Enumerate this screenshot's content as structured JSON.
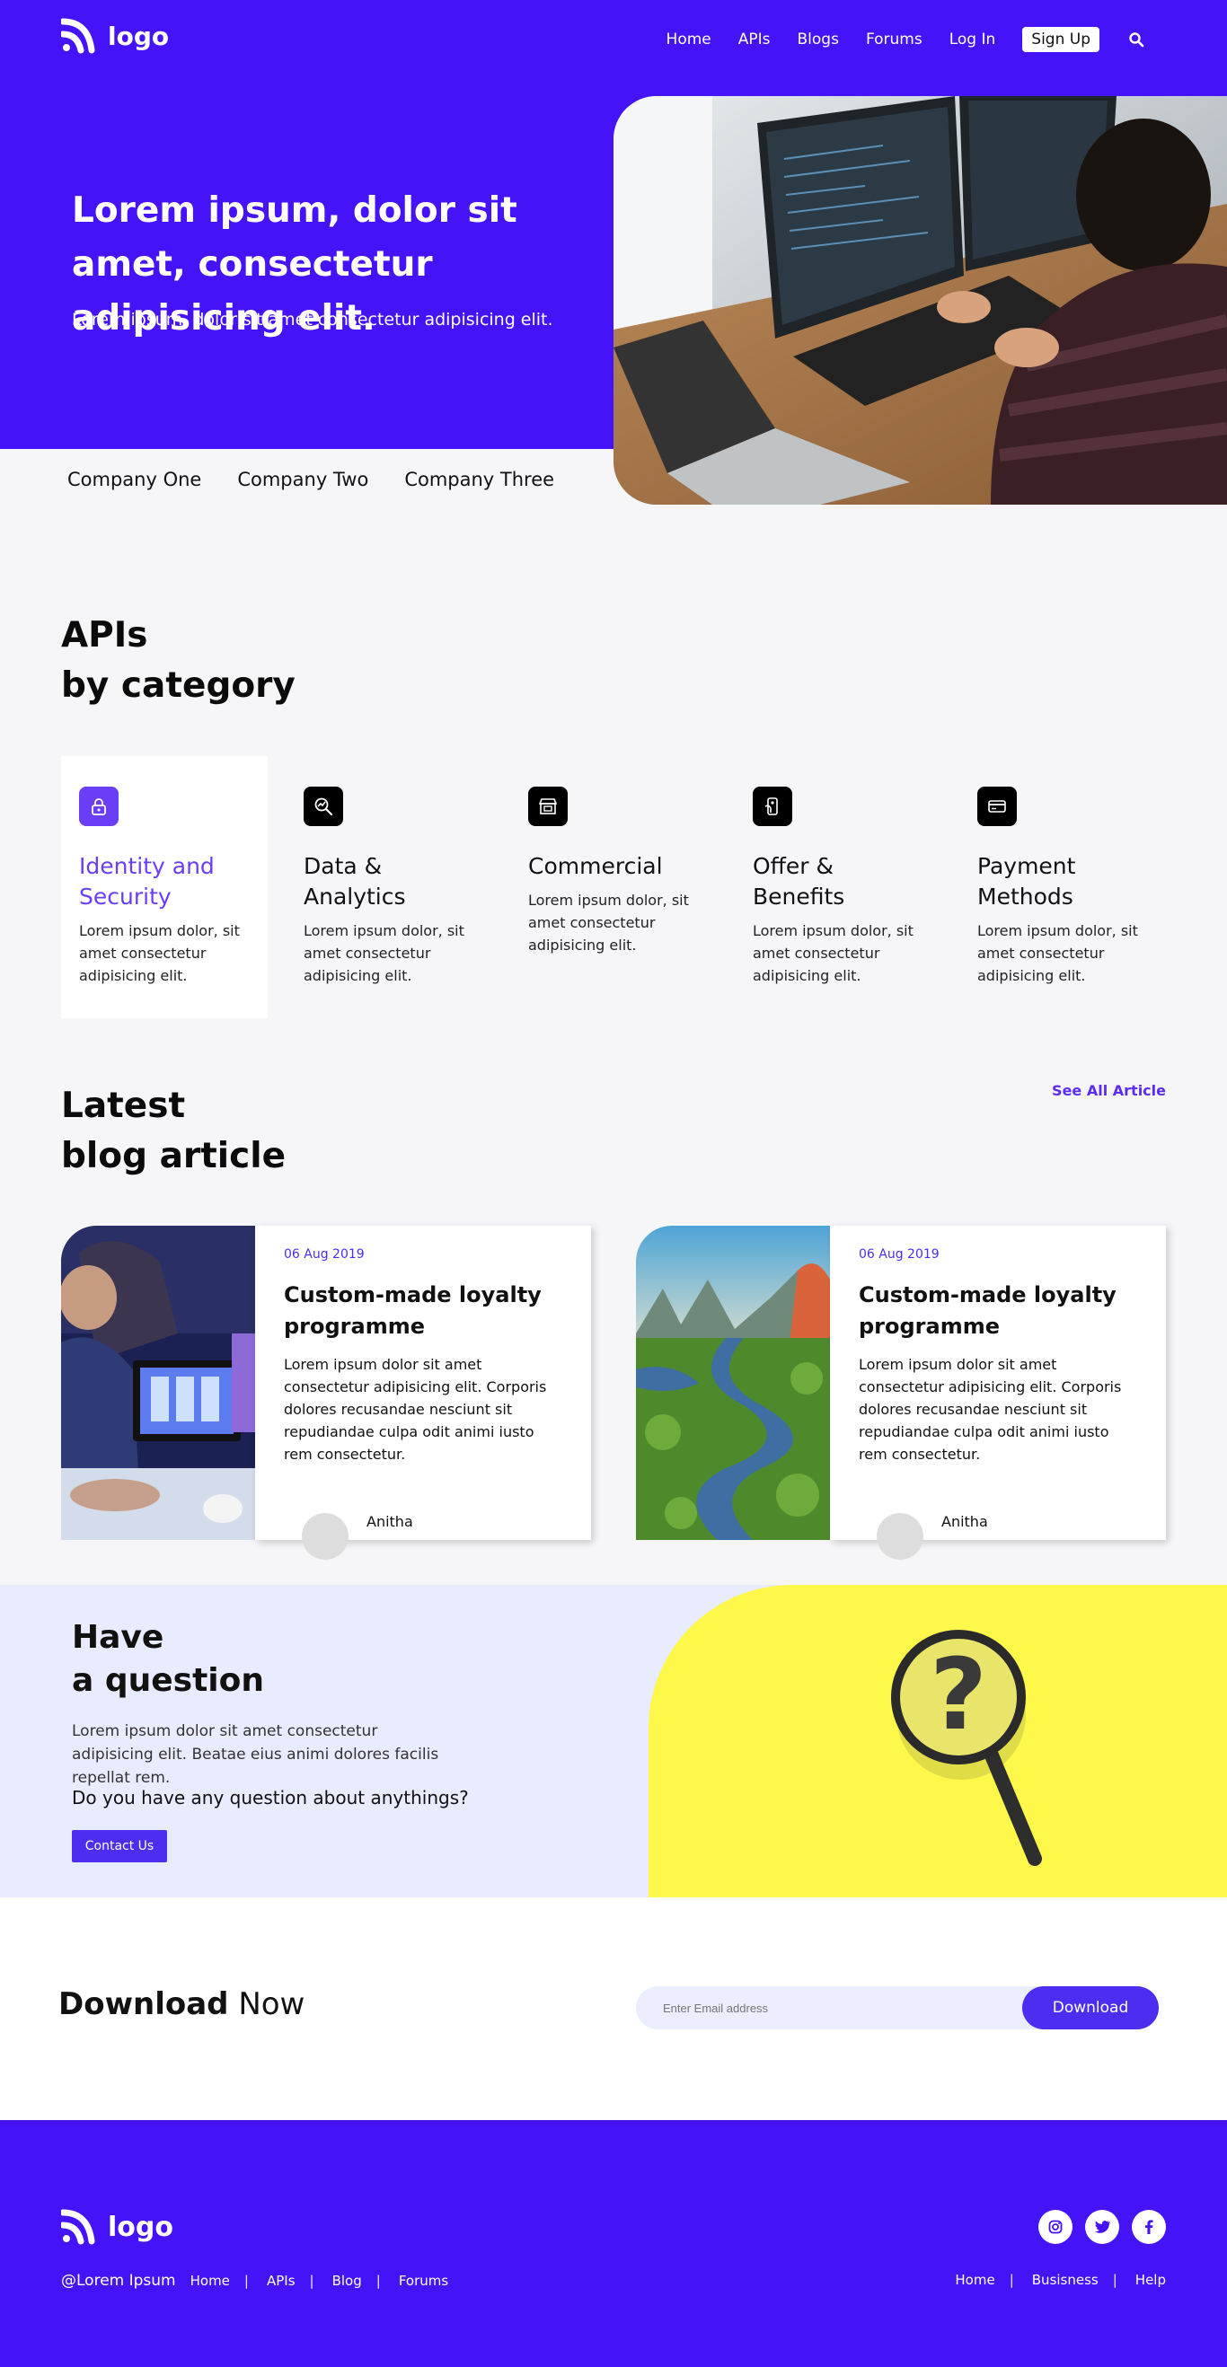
{
  "header": {
    "logo_text": "logo",
    "nav": [
      "Home",
      "APIs",
      "Blogs",
      "Forums",
      "Log In"
    ],
    "signup": "Sign Up"
  },
  "hero": {
    "title": "Lorem ipsum, dolor sit amet, consectetur adipisicing elit.",
    "subtitle": "Lorem ipsum, dolor sit amet consectetur adipisicing elit."
  },
  "companies": [
    "Company One",
    "Company Two",
    "Company Three"
  ],
  "categories": {
    "title_line1": "APIs",
    "title_line2": "by category",
    "items": [
      {
        "icon": "lock-icon",
        "title": "Identity and Security",
        "desc": "Lorem ipsum dolor, sit amet consectetur adipisicing elit."
      },
      {
        "icon": "chart-search-icon",
        "title": "Data & Analytics",
        "desc": "Lorem ipsum dolor, sit amet consectetur adipisicing elit."
      },
      {
        "icon": "store-icon",
        "title": "Commercial",
        "desc": "Lorem ipsum dolor, sit amet consectetur adipisicing elit."
      },
      {
        "icon": "phone-offer-icon",
        "title": "Offer & Benefits",
        "desc": "Lorem ipsum dolor, sit amet consectetur adipisicing elit."
      },
      {
        "icon": "card-icon",
        "title": "Payment Methods",
        "desc": "Lorem ipsum dolor, sit amet consectetur adipisicing elit."
      }
    ]
  },
  "blog": {
    "title_line1": "Latest",
    "title_line2": "blog article",
    "see_all": "See All Article",
    "articles": [
      {
        "date": "06 Aug 2019",
        "title": "Custom-made loyalty programme",
        "text": "Lorem ipsum dolor sit amet consectetur adipisicing elit. Corporis dolores recusandae nesciunt sit repudiandae culpa odit animi iusto rem consectetur.",
        "author": "Anitha"
      },
      {
        "date": "06 Aug 2019",
        "title": "Custom-made loyalty programme",
        "text": "Lorem ipsum dolor sit amet consectetur adipisicing elit. Corporis dolores recusandae nesciunt sit repudiandae culpa odit animi iusto rem consectetur.",
        "author": "Anitha"
      }
    ]
  },
  "question": {
    "title_line1": "Have",
    "title_line2": "a question",
    "text": "Lorem ipsum dolor sit amet consectetur adipisicing elit. Beatae eius animi dolores facilis repellat rem.",
    "ask": "Do you have any question about anythings?",
    "button": "Contact Us"
  },
  "download": {
    "title_bold": "Download",
    "title_rest": "Now",
    "placeholder": "Enter Email address",
    "button": "Download"
  },
  "footer": {
    "logo_text": "logo",
    "brand": "@Lorem Ipsum",
    "left_links": [
      "Home",
      "APIs",
      "Blog",
      "Forums"
    ],
    "right_links": [
      "Home",
      "Busisness",
      "Help"
    ],
    "socials": [
      "instagram-icon",
      "twitter-icon",
      "facebook-icon"
    ]
  },
  "colors": {
    "primary": "#4413f7",
    "accent": "#4d2df0",
    "yellow": "#fdf84a",
    "light": "#e9ebfe"
  }
}
